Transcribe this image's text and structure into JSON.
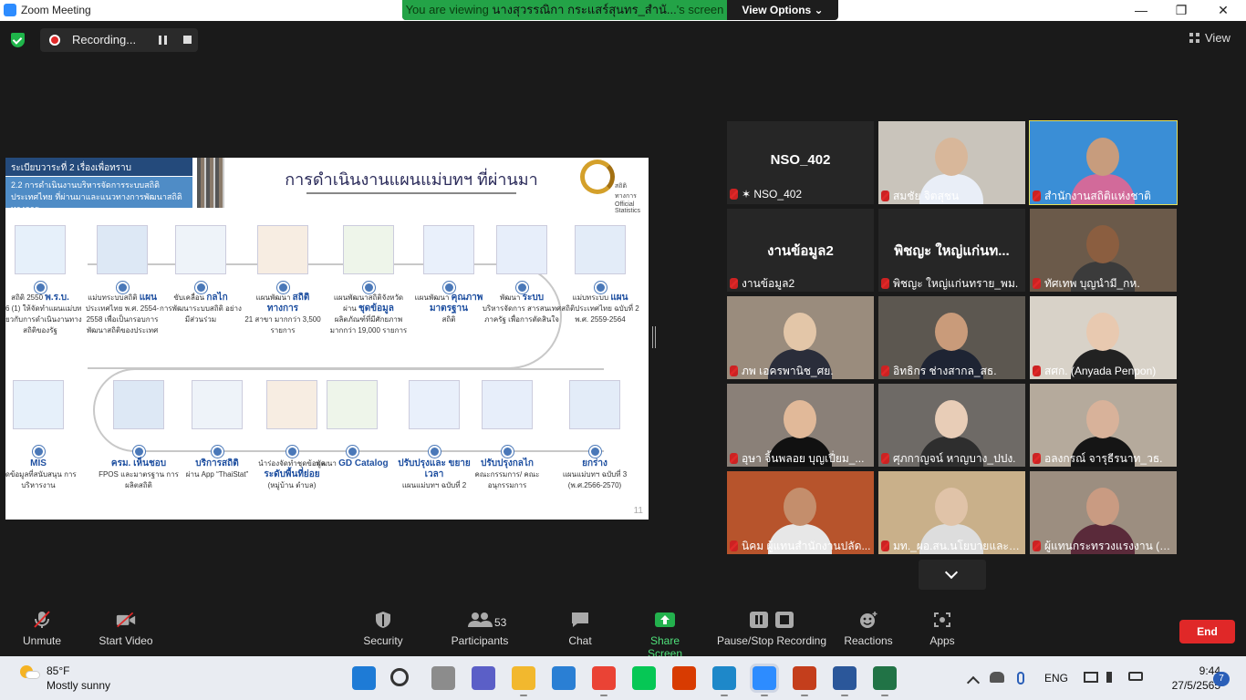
{
  "window": {
    "title": "Zoom Meeting",
    "controls": [
      "—",
      "❐",
      "✕"
    ]
  },
  "share_banner": {
    "prefix": "You are viewing ",
    "presenter": "นางสุวรรณิกา กระแสร์สุนทร_สำนั...",
    "suffix": "'s screen",
    "view_options": "View Options ⌄"
  },
  "recording": {
    "label": "Recording..."
  },
  "view_menu": {
    "label": "View"
  },
  "slide": {
    "header1": "ระเบียบวาระที่ 2 เรื่องเพื่อทราบ",
    "header2": "2.2 การดำเนินงานบริหารจัดการระบบสถิติประเทศไทย ที่ผ่านมาและแนวทางการพัฒนาสถิติทางการ",
    "title": "การดำเนินงานแผนแม่บทฯ ที่ผ่านมา",
    "logo_text": "สถิติทางการ Official Statistics",
    "page_number": "11",
    "top_items": [
      {
        "head": "พ.ร.บ.",
        "tail": "สถิติ 2550",
        "desc": "ม.6 (1) ให้จัดทำแผนแม่บทเกี่ยวกับการดำเนินงานทางสถิติของรัฐ"
      },
      {
        "head": "แผน",
        "tail": "แม่บทระบบสถิติ",
        "desc": "ประเทศไทย พ.ศ. 2554-2558 เพื่อเป็นกรอบการพัฒนาสถิติของประเทศ"
      },
      {
        "head": "กลไก",
        "tail": "ขับเคลื่อน",
        "desc": "การพัฒนาระบบสถิติ อย่างมีส่วนร่วม"
      },
      {
        "head": "สถิติ ทางการ",
        "tail": "แผนพัฒนา",
        "desc": "21 สาขา มากกว่า 3,500 รายการ"
      },
      {
        "head": "ชุดข้อมูล",
        "tail": "แผนพัฒนาสถิติจังหวัด ผ่าน",
        "desc": "ผลิตภัณฑ์ที่มีศักยภาพ มากกว่า 19,000 รายการ"
      },
      {
        "head": "คุณภาพ มาตรฐาน",
        "tail": "แผนพัฒนา",
        "desc": "สถิติ"
      },
      {
        "head": "ระบบ",
        "tail": "พัฒนา",
        "desc": "บริหารจัดการ สารสนเทศภาครัฐ เพื่อการตัดสินใจ"
      },
      {
        "head": "แผน",
        "tail": "แม่บทระบบ",
        "desc": "สถิติประเทศไทย ฉบับที่ 2 พ.ศ. 2559-2564"
      }
    ],
    "bottom_items": [
      {
        "head": "MIS",
        "tail": "",
        "desc": "ชุดข้อมูลที่สนับสนุน การบริหารงาน"
      },
      {
        "head": "ครม. เห็นชอบ",
        "tail": "",
        "desc": "FPOS และมาตรฐาน การผลิตสถิติ"
      },
      {
        "head": "บริการสถิติ",
        "tail": "",
        "desc": "ผ่าน App “ThaiStat”"
      },
      {
        "head": "ระดับพื้นที่ย่อย",
        "tail": "นำร่องจัดทำชุดข้อมูล",
        "desc": "(หมู่บ้าน ตำบล)"
      },
      {
        "head": "GD Catalog",
        "tail": "พัฒนา",
        "desc": ""
      },
      {
        "head": "ปรับปรุงและ ขยายเวลา",
        "tail": "",
        "desc": "แผนแม่บทฯ ฉบับที่ 2"
      },
      {
        "head": "ปรับปรุงกลไก",
        "tail": "",
        "desc": "คณะกรรมการ/ คณะอนุกรรมการ"
      },
      {
        "head": "ยกร่าง",
        "tail": "",
        "desc": "แผนแม่บทฯ ฉบับที่ 3 (พ.ศ.2566-2570)"
      }
    ]
  },
  "participants": [
    {
      "name": "NSO_402",
      "big": "NSO_402",
      "pinned": true,
      "video": false
    },
    {
      "name": "สมชัย  จิตสุชน",
      "big": "",
      "video": true,
      "bg": "#c9c4bb",
      "skin": "#d8b79a",
      "shirt": "#e9eef7"
    },
    {
      "name": "สำนักงานสถิติแห่งชาติ",
      "big": "",
      "video": true,
      "active": true,
      "bg": "#3a8ed6",
      "skin": "#c79c7d",
      "shirt": "#d26a9a"
    },
    {
      "name": "งานข้อมูล2",
      "big": "งานข้อมูล2",
      "video": false
    },
    {
      "name": "พิชญะ ใหญ่แก่นทราย_พม.",
      "big": "พิชญะ ใหญ่แก่นท...",
      "video": false
    },
    {
      "name": "ทัศเทพ  บุญนำมี_กห.",
      "big": "",
      "video": true,
      "bg": "#6b5a4a",
      "skin": "#8b5e40",
      "shirt": "#3b3b3b"
    },
    {
      "name": "ภพ  เอครพานิช_ศย.",
      "big": "",
      "video": true,
      "bg": "#9a8c7d",
      "skin": "#e3c6a8",
      "shirt": "#2a2d3a"
    },
    {
      "name": "อิทธิกร  ช่างสากล_สธ.",
      "big": "",
      "video": true,
      "bg": "#5c5750",
      "skin": "#c99b7a",
      "shirt": "#1e2433"
    },
    {
      "name": "สศก. (Anyada Penpon)",
      "big": "",
      "video": true,
      "bg": "#d8d2c8",
      "skin": "#e8c9b0",
      "shirt": "#222"
    },
    {
      "name": "อุษา จิ้นพลอย บุญเปี่ยม_...",
      "big": "",
      "video": true,
      "bg": "#8a8078",
      "skin": "#e1b999",
      "shirt": "#111"
    },
    {
      "name": "ศุภกาญจน์  หาญบาง_ปปง.",
      "big": "",
      "video": true,
      "bg": "#6e6a66",
      "skin": "#e8cdb7",
      "shirt": "#2e2e2e"
    },
    {
      "name": "อลงกรณ์  จารุธีรนาท_วธ.",
      "big": "",
      "video": true,
      "bg": "#b5aa9c",
      "skin": "#d8b29a",
      "shirt": "#151515"
    },
    {
      "name": "นิคม ผู้แทนสำนักงานปลัด...",
      "big": "",
      "video": true,
      "bg": "#b7542c",
      "skin": "#c48e6c",
      "shirt": "#e7e7e7"
    },
    {
      "name": "มท._ผอ.สน.นโยบายและแ...",
      "big": "",
      "video": true,
      "bg": "#c9b08a",
      "skin": "#e0c3a8",
      "shirt": "#ddd"
    },
    {
      "name": "ผู้แทนกระทรวงแรงงาน (ผ...",
      "big": "",
      "video": true,
      "bg": "#9c8e80",
      "skin": "#c99b82",
      "shirt": "#5a2a3a"
    }
  ],
  "toolbar": {
    "unmute": "Unmute",
    "start_video": "Start Video",
    "security": "Security",
    "participants": "Participants",
    "participants_count": "53",
    "chat": "Chat",
    "share_screen": "Share Screen",
    "pause_stop": "Pause/Stop Recording",
    "reactions": "Reactions",
    "apps": "Apps",
    "end": "End"
  },
  "taskbar": {
    "weather_temp": "85°F",
    "weather_cond": "Mostly sunny",
    "lang": "ENG",
    "time": "9:44",
    "date": "27/5/2565",
    "notifications": "7",
    "apps": [
      "windows-start",
      "search",
      "task-view",
      "teams",
      "file-explorer",
      "mail",
      "chrome",
      "line",
      "office",
      "edge",
      "zoom",
      "powerpoint",
      "word",
      "excel"
    ]
  }
}
